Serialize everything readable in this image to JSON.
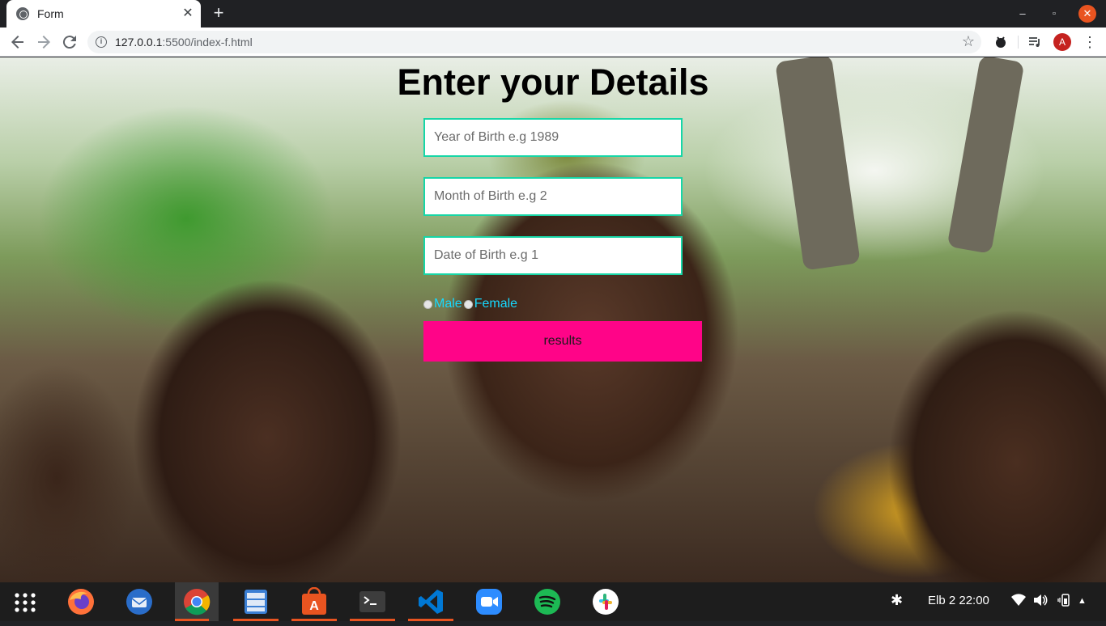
{
  "browser": {
    "tab_title": "Form",
    "tab_close": "✕",
    "new_tab": "+",
    "url_host": "127.0.0.1",
    "url_path": ":5500/index-f.html",
    "profile_initial": "A",
    "window_controls": {
      "minimize": "–",
      "maximize": "▫",
      "close": "✕"
    }
  },
  "page": {
    "title": "Enter your Details",
    "fields": {
      "year_placeholder": "Year of Birth e.g 1989",
      "month_placeholder": "Month of Birth e.g 2",
      "date_placeholder": "Date of Birth e.g 1"
    },
    "gender": {
      "male_label": "Male",
      "female_label": "Female"
    },
    "submit_label": "results",
    "colors": {
      "field_border": "#17d6a7",
      "gender_label": "#16d9ff",
      "button_bg": "#ff0488"
    }
  },
  "taskbar": {
    "apps": [
      {
        "name": "firefox",
        "color": "#ff7139"
      },
      {
        "name": "thunderbird",
        "color": "#2a6dc9"
      },
      {
        "name": "chrome",
        "color": "#4285f4"
      },
      {
        "name": "files",
        "color": "#3b7fd4"
      },
      {
        "name": "software",
        "color": "#e95420"
      },
      {
        "name": "terminal",
        "color": "#3d3d3d"
      },
      {
        "name": "vscode",
        "color": "#0078d4"
      },
      {
        "name": "zoom",
        "color": "#2d8cff"
      },
      {
        "name": "spotify",
        "color": "#1db954"
      },
      {
        "name": "slack",
        "color": "#ffffff"
      }
    ],
    "clock": "Elb 2  22:00"
  }
}
